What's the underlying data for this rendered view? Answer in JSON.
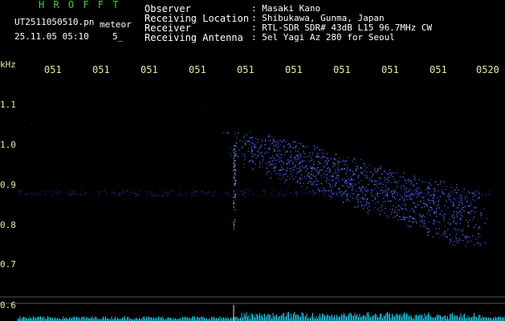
{
  "app_title": "H R O F F T",
  "file_name": "UT2511050510.pn",
  "mode_label": "meteor",
  "timestamp": "25.11.05 05:10",
  "count": "5_",
  "meta": [
    {
      "key": "Observer",
      "value": ": Masaki Kano"
    },
    {
      "key": "Receiving Location",
      "value": ": Shibukawa, Gunma, Japan"
    },
    {
      "key": "Receiver",
      "value": ": RTL-SDR SDR# 43dB L15 96.7MHz CW"
    },
    {
      "key": "Receiving Antenna",
      "value": ": 5el Yagi Az 280 for Seoul"
    }
  ],
  "y_unit": "kHz",
  "x_ticks": [
    "051",
    "051",
    "051",
    "051",
    "051",
    "051",
    "051",
    "051",
    "051",
    "0520"
  ],
  "y_ticks": [
    "1.1",
    "1.0",
    "0.9",
    "0.8",
    "0.7",
    "0.6"
  ],
  "colors": {
    "signal": "#4a5cff",
    "noise": "#1c2a8a",
    "baseline": "#20c8e8",
    "tick": "#e8e8a0",
    "title": "#3ecf3e"
  }
}
